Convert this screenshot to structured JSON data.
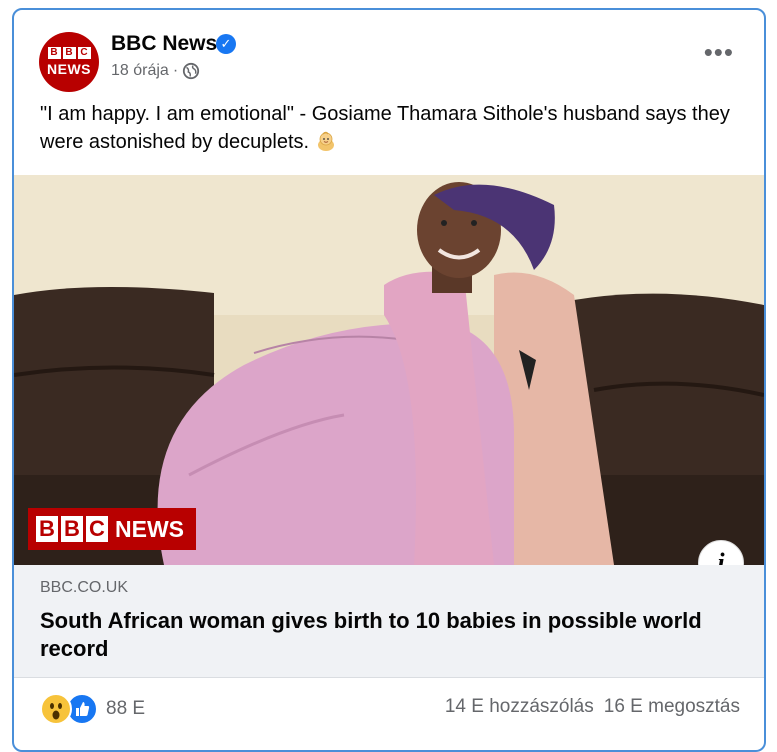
{
  "post": {
    "page_name": "BBC News",
    "time": "18 órája",
    "separator": "·",
    "text": "\"I am happy. I am emotional\" - Gosiame Thamara Sithole's husband says they were astonished by decuplets.",
    "more_label": "•••"
  },
  "avatar": {
    "letters": [
      "B",
      "B",
      "C"
    ],
    "word": "NEWS"
  },
  "watermark": {
    "letters": [
      "B",
      "B",
      "C"
    ],
    "word": "NEWS"
  },
  "link": {
    "domain": "BBC.CO.UK",
    "title": "South African woman gives birth to 10 babies in possible world record",
    "info_label": "i"
  },
  "footer": {
    "reaction_count": "88 E",
    "comments": "14 E hozzászólás",
    "shares": "16 E megosztás"
  },
  "colors": {
    "brand_red": "#b80000",
    "facebook_blue": "#1877f2",
    "card_border": "#4a8fd9"
  },
  "icons": [
    "verified-icon",
    "globe-icon",
    "baby-emoji-icon",
    "wow-reaction-icon",
    "like-reaction-icon",
    "info-icon"
  ]
}
